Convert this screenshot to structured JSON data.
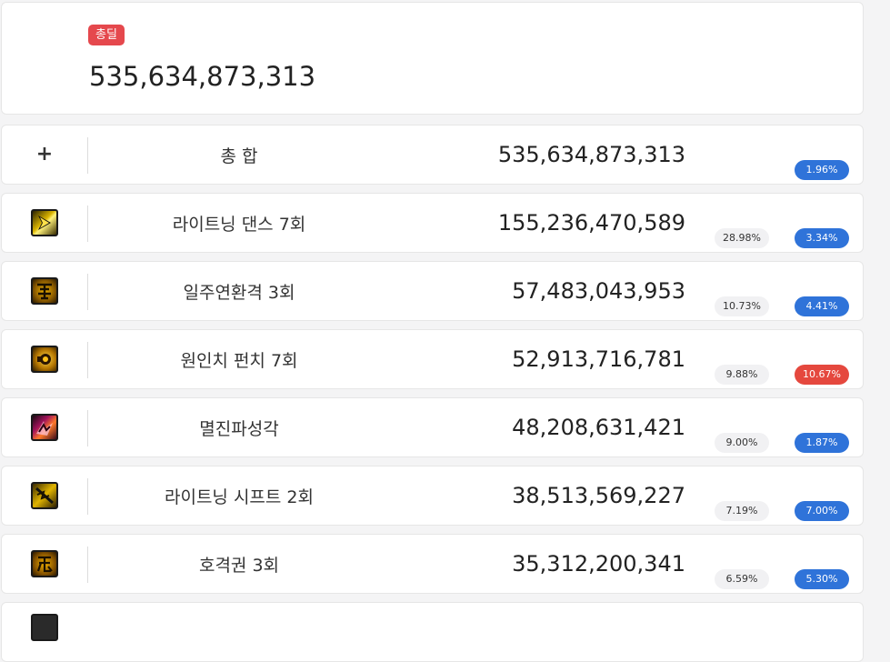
{
  "summary": {
    "badge_label": "총딜",
    "total_value": "535,634,873,313"
  },
  "rows": [
    {
      "name": "총 합",
      "value": "535,634,873,313",
      "share": "",
      "change": "1.96%",
      "change_color": "#2f73d9",
      "icon": "plus-icon"
    },
    {
      "name": "라이트닝 댄스 7회",
      "value": "155,236,470,589",
      "share": "28.98%",
      "change": "3.34%",
      "change_color": "#2f73d9",
      "icon": "lightning-dance-icon"
    },
    {
      "name": "일주연환격 3회",
      "value": "57,483,043,953",
      "share": "10.73%",
      "change": "4.41%",
      "change_color": "#2f73d9",
      "icon": "chain-strike-icon"
    },
    {
      "name": "원인치 펀치 7회",
      "value": "52,913,716,781",
      "share": "9.88%",
      "change": "10.67%",
      "change_color": "#e5483e",
      "icon": "one-inch-punch-icon"
    },
    {
      "name": "멸진파성각",
      "value": "48,208,631,421",
      "share": "9.00%",
      "change": "1.87%",
      "change_color": "#2f73d9",
      "icon": "destruction-wave-icon"
    },
    {
      "name": "라이트닝 시프트 2회",
      "value": "38,513,569,227",
      "share": "7.19%",
      "change": "7.00%",
      "change_color": "#2f73d9",
      "icon": "lightning-shift-icon"
    },
    {
      "name": "호격권 3회",
      "value": "35,312,200,341",
      "share": "6.59%",
      "change": "5.30%",
      "change_color": "#2f73d9",
      "icon": "tiger-fist-icon"
    }
  ]
}
